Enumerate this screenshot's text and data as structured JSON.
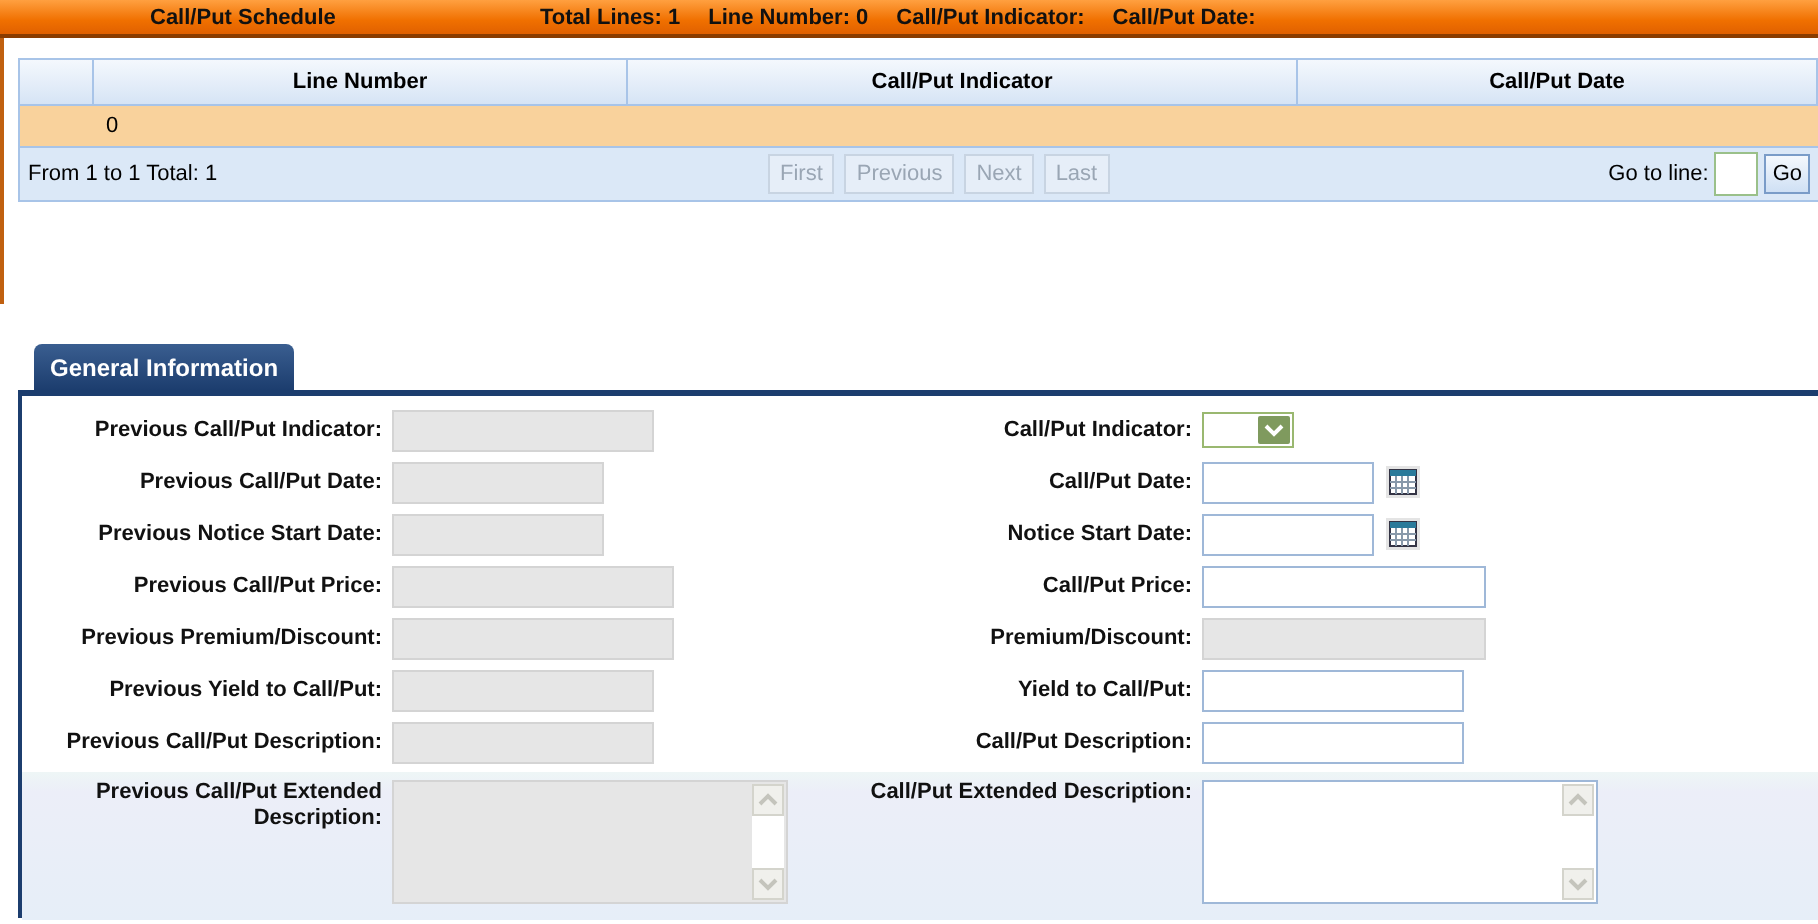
{
  "header": {
    "title": "Call/Put Schedule",
    "stats": [
      {
        "label": "Total Lines:",
        "value": "1"
      },
      {
        "label": "Line Number:",
        "value": "0"
      },
      {
        "label": "Call/Put Indicator:"
      },
      {
        "label": "Call/Put Date:"
      }
    ]
  },
  "table": {
    "columns": [
      "Line Number",
      "Call/Put Indicator",
      "Call/Put Date"
    ],
    "rows": [
      {
        "cells": [
          "0"
        ],
        "selected": true
      }
    ]
  },
  "pager": {
    "summary": "From 1 to 1 Total: 1",
    "buttons": [
      {
        "label": "First",
        "disabled": true
      },
      {
        "label": "Previous",
        "disabled": true
      },
      {
        "label": "Next",
        "disabled": true
      },
      {
        "label": "Last",
        "disabled": true
      }
    ],
    "goto_label": "Go to line:",
    "go_button": "Go"
  },
  "tabs": [
    {
      "label": "General Information",
      "selected": true
    }
  ],
  "form_rows": [
    {
      "left": {
        "label": "Previous Call/Put Indicator:",
        "kind": "text",
        "disabled": true
      },
      "right": {
        "label": "Call/Put Indicator:",
        "kind": "select",
        "disabled": false
      }
    },
    {
      "left": {
        "label": "Previous Call/Put Date:",
        "kind": "text",
        "disabled": true
      },
      "right": {
        "label": "Call/Put Date:",
        "kind": "date",
        "disabled": false
      }
    },
    {
      "left": {
        "label": "Previous Notice Start Date:",
        "kind": "text",
        "disabled": true
      },
      "right": {
        "label": "Notice Start Date:",
        "kind": "date",
        "disabled": false
      }
    },
    {
      "left": {
        "label": "Previous Call/Put Price:",
        "kind": "text",
        "disabled": true
      },
      "right": {
        "label": "Call/Put Price:",
        "kind": "text",
        "disabled": false
      }
    },
    {
      "left": {
        "label": "Previous Premium/Discount:",
        "kind": "text",
        "disabled": true
      },
      "right": {
        "label": "Premium/Discount:",
        "kind": "text",
        "disabled": true
      }
    },
    {
      "left": {
        "label": "Previous Yield to Call/Put:",
        "kind": "text",
        "disabled": true
      },
      "right": {
        "label": "Yield to Call/Put:",
        "kind": "text",
        "disabled": false
      }
    },
    {
      "left": {
        "label": "Previous Call/Put Description:",
        "kind": "text",
        "disabled": true
      },
      "right": {
        "label": "Call/Put Description:",
        "kind": "text",
        "disabled": false
      }
    },
    {
      "left": {
        "label": "Previous Call/Put Extended Description:",
        "kind": "textarea",
        "disabled": true
      },
      "right": {
        "label": "Call/Put Extended Description:",
        "kind": "textarea",
        "disabled": false
      }
    }
  ]
}
